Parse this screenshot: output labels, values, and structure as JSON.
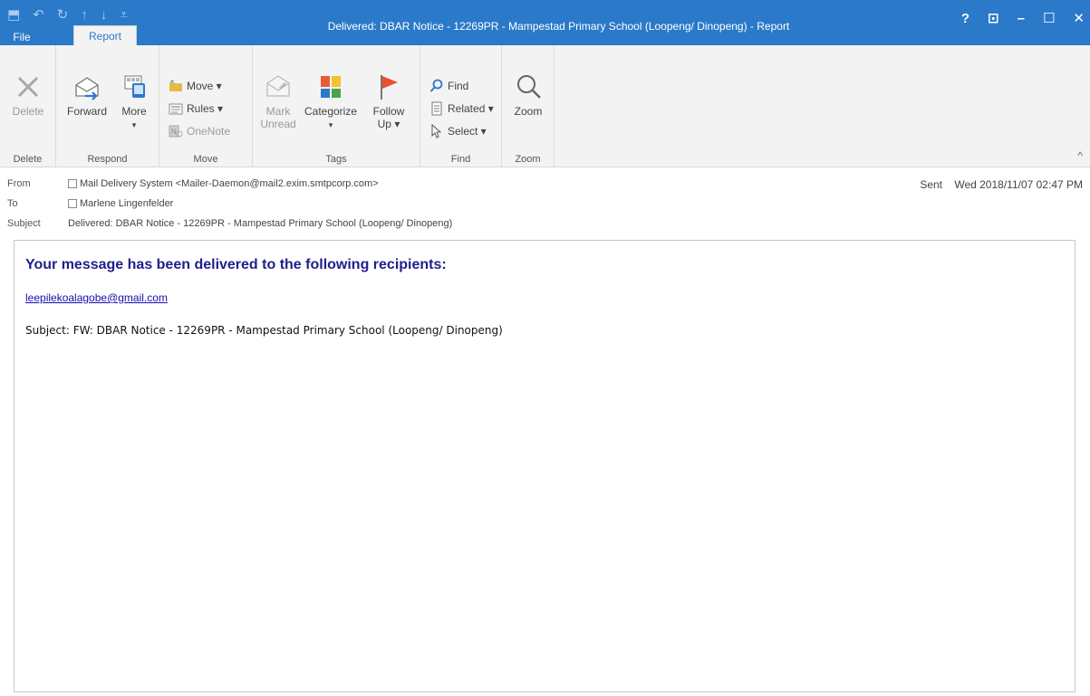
{
  "window": {
    "title": "Delivered: DBAR Notice - 12269PR - Mampestad Primary School (Loopeng/ Dinopeng) - Report"
  },
  "qat": {
    "save_icon": "⬒",
    "undo_icon": "↶",
    "redo_icon": "↻",
    "up_icon": "↑",
    "down_icon": "↓",
    "customize_icon": "⩡"
  },
  "controls": {
    "help": "?",
    "ribbon_display": "⊡",
    "minimize": "–",
    "maximize": "☐",
    "close": "✕"
  },
  "tabs": {
    "file": "File",
    "report": "Report"
  },
  "ribbon": {
    "delete_group": {
      "label": "Delete",
      "delete_btn": "Delete"
    },
    "respond_group": {
      "label": "Respond",
      "forward_btn": "Forward",
      "more_btn": "More",
      "more_caret": "▾"
    },
    "move_group": {
      "label": "Move",
      "move_btn": "Move ▾",
      "rules_btn": "Rules ▾",
      "onenote_btn": "OneNote"
    },
    "tags_group": {
      "label": "Tags",
      "mark_unread_line1": "Mark",
      "mark_unread_line2": "Unread",
      "categorize_btn": "Categorize",
      "categorize_caret": "▾",
      "follow_up_line1": "Follow",
      "follow_up_line2": "Up ▾"
    },
    "find_group": {
      "label": "Find",
      "find_btn": "Find",
      "related_btn": "Related ▾",
      "select_btn": "Select ▾"
    },
    "zoom_group": {
      "label": "Zoom",
      "zoom_btn": "Zoom"
    },
    "collapse_icon": "^"
  },
  "header": {
    "from_label": "From",
    "from_value": "Mail Delivery System <Mailer-Daemon@mail2.exim.smtpcorp.com>",
    "to_label": "To",
    "to_value": "Marlene Lingenfelder",
    "subject_label": "Subject",
    "subject_value": "Delivered: DBAR Notice - 12269PR - Mampestad Primary School (Loopeng/ Dinopeng)",
    "sent_label": "Sent",
    "sent_value": "Wed 2018/11/07 02:47 PM"
  },
  "body": {
    "heading": "Your message has been delivered to the following recipients:",
    "recipient": "leepilekoalagobe@gmail.com",
    "subject_line": "Subject: FW: DBAR Notice - 12269PR - Mampestad Primary School (Loopeng/ Dinopeng)"
  },
  "colors": {
    "titlebar": "#2b79c9",
    "heading": "#1f1f8c",
    "link": "#1a0dab"
  }
}
